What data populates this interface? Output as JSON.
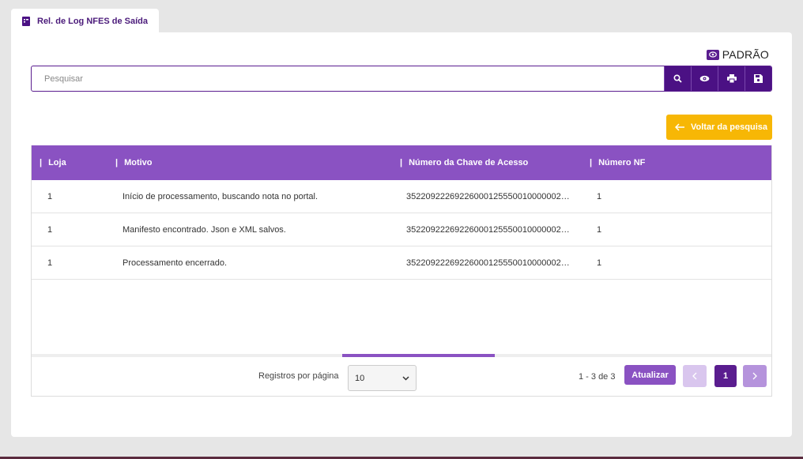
{
  "tab": {
    "label": "Rel. de Log NFES de Saída"
  },
  "view": {
    "label": "PADRÃO"
  },
  "search": {
    "placeholder": "Pesquisar",
    "value": ""
  },
  "toolbar": {
    "icons": [
      "search-icon",
      "eye-icon",
      "print-icon",
      "save-icon"
    ]
  },
  "back_button": {
    "label": "Voltar da pesquisa"
  },
  "grid": {
    "columns": [
      "Loja",
      "Motivo",
      "Número da Chave de Acesso",
      "Número NF"
    ],
    "rows": [
      {
        "loja": "1",
        "motivo": "Início de processamento, buscando nota no portal.",
        "chave": "35220922269226000125550010000002…",
        "nf": "1"
      },
      {
        "loja": "1",
        "motivo": "Manifesto encontrado. Json e XML salvos.",
        "chave": "35220922269226000125550010000002…",
        "nf": "1"
      },
      {
        "loja": "1",
        "motivo": "Processamento encerrado.",
        "chave": "35220922269226000125550010000002…",
        "nf": "1"
      }
    ]
  },
  "pagination": {
    "records_per_page_label": "Registros por página",
    "records_per_page_value": "10",
    "range_label": "1 - 3 de 3",
    "refresh_label": "Atualizar",
    "current_page": "1"
  },
  "colors": {
    "primary": "#4b1184",
    "header": "#8a52c2",
    "accent": "#f7b705"
  }
}
